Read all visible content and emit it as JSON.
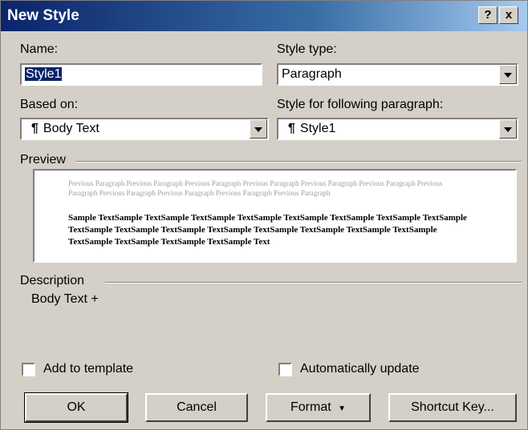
{
  "window": {
    "title": "New Style",
    "help_label": "?",
    "close_label": "x"
  },
  "name": {
    "label": "Name:",
    "value": "Style1"
  },
  "style_type": {
    "label": "Style type:",
    "value": "Paragraph"
  },
  "based_on": {
    "label": "Based on:",
    "value": "Body Text",
    "icon": "pilcrow-icon"
  },
  "following": {
    "label": "Style for following paragraph:",
    "value": "Style1",
    "icon": "pilcrow-icon"
  },
  "preview": {
    "label": "Preview",
    "previous_text": "Previous Paragraph Previous Paragraph Previous Paragraph Previous Paragraph Previous Paragraph Previous Paragraph Previous Paragraph Previous Paragraph Previous Paragraph Previous Paragraph Previous Paragraph",
    "sample_text": "Sample TextSample TextSample TextSample TextSample TextSample TextSample TextSample TextSample TextSample TextSample TextSample TextSample TextSample TextSample TextSample TextSample TextSample TextSample TextSample TextSample Text"
  },
  "description": {
    "label": "Description",
    "text": "Body Text +"
  },
  "options": {
    "add_to_template": "Add to template",
    "auto_update": "Automatically update"
  },
  "buttons": {
    "ok": "OK",
    "cancel": "Cancel",
    "format": "Format",
    "shortcut": "Shortcut Key..."
  },
  "colors": {
    "title_start": "#0a246a",
    "title_end": "#a6caf0",
    "face": "#d4d0c8"
  }
}
